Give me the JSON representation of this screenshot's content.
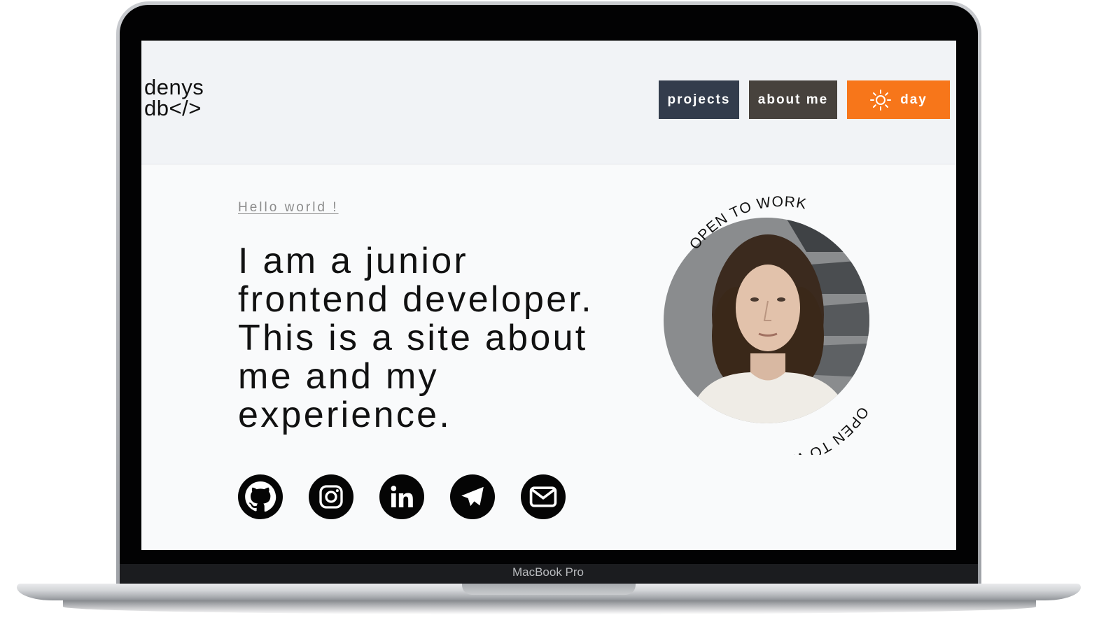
{
  "device": {
    "label": "MacBook Pro"
  },
  "logo": {
    "line1": "denys",
    "line2": "db</>"
  },
  "nav": {
    "projects_label": "projects",
    "about_label": "about me",
    "theme_label": "day",
    "theme_icon": "sun-icon"
  },
  "hero": {
    "greeting": "Hello world !",
    "headline": "I am a junior frontend developer. This is a site about me and my experience."
  },
  "social": [
    {
      "name": "GitHub",
      "icon": "github-icon"
    },
    {
      "name": "Instagram",
      "icon": "instagram-icon"
    },
    {
      "name": "LinkedIn",
      "icon": "linkedin-icon"
    },
    {
      "name": "Telegram",
      "icon": "telegram-icon"
    },
    {
      "name": "Email",
      "icon": "email-icon"
    }
  ],
  "badge": {
    "text_top": "OPEN TO WORK",
    "text_bottom": "OPEN TO WORK"
  },
  "colors": {
    "projects_bg": "#333c4c",
    "about_bg": "#47423d",
    "day_bg": "#f7761a",
    "page_bg": "#f9fafb",
    "header_bg": "#f1f3f6"
  }
}
